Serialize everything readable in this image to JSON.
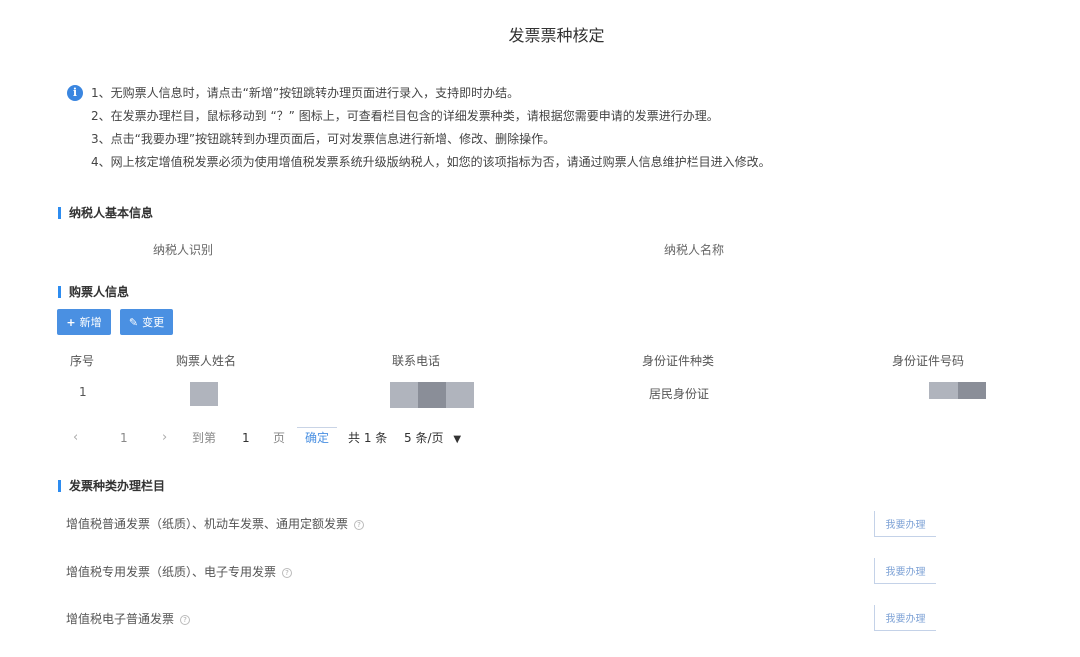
{
  "page_title": "发票票种核定",
  "notice": {
    "icon": "info-icon",
    "lines": [
      "1、无购票人信息时，请点击“新增”按钮跳转办理页面进行录入，支持即时办结。",
      "2、在发票办理栏目，鼠标移动到 “？” 图标上，可查看栏目包含的详细发票种类，请根据您需要申请的发票进行办理。",
      "3、点击“我要办理”按钮跳转到办理页面后，可对发票信息进行新增、修改、删除操作。",
      "4、网上核定增值税发票必须为使用增值税发票系统升级版纳税人，如您的该项指标为否，请通过购票人信息维护栏目进入修改。"
    ]
  },
  "taxpayer_section": {
    "title": "纳税人基本信息",
    "id_label": "纳税人识别",
    "name_label": "纳税人名称"
  },
  "buyer_section": {
    "title": "购票人信息",
    "add_button": "新增",
    "edit_button": "变更",
    "columns": [
      "序号",
      "购票人姓名",
      "联系电话",
      "身份证件种类",
      "身份证件号码"
    ],
    "rows": [
      {
        "index": "1",
        "id_type": "居民身份证"
      }
    ],
    "pager": {
      "prev": "‹",
      "page": "1",
      "next": "›",
      "goto_label": "到第",
      "goto_value": "1",
      "page_unit": "页",
      "confirm": "确定",
      "total": "共 1 条",
      "page_size": "5 条/页"
    }
  },
  "invoice_section": {
    "title": "发票种类办理栏目",
    "rows": [
      {
        "label": "增值税普通发票（纸质）、机动车发票、通用定额发票",
        "button": "我要办理"
      },
      {
        "label": "增值税专用发票（纸质）、电子专用发票",
        "button": "我要办理"
      },
      {
        "label": "增值税电子普通发票",
        "button": "我要办理"
      }
    ]
  },
  "colors": {
    "accent": "#2d8cf0",
    "button": "#4a90e2"
  }
}
